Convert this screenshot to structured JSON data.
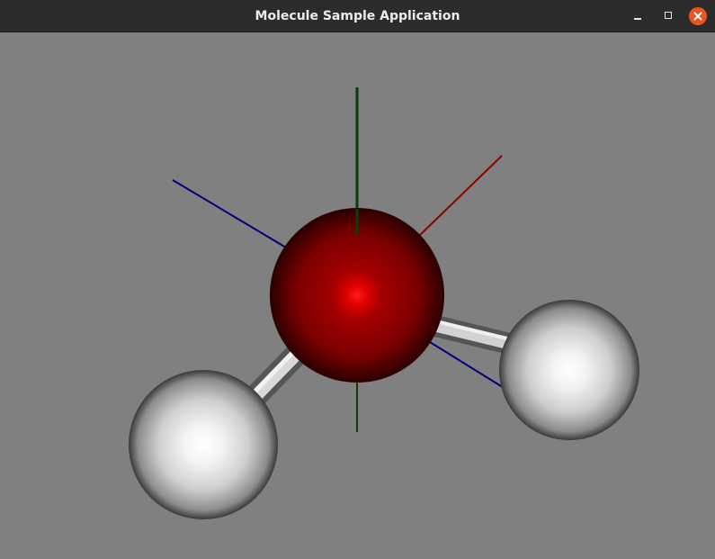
{
  "window": {
    "title": "Molecule Sample Application",
    "controls": {
      "minimize_icon": "minimize-icon",
      "maximize_icon": "maximize-icon",
      "close_icon": "close-icon"
    }
  },
  "scene": {
    "background_color": "#808080",
    "molecule": "water",
    "atoms": [
      {
        "element": "O",
        "color": "#8b0000"
      },
      {
        "element": "H",
        "color": "#f0f0f0"
      },
      {
        "element": "H",
        "color": "#f0f0f0"
      }
    ],
    "axes": [
      {
        "axis": "x",
        "color": "#8b0000"
      },
      {
        "axis": "y",
        "color": "#0a3d0a"
      },
      {
        "axis": "z",
        "color": "#00007a"
      }
    ]
  }
}
